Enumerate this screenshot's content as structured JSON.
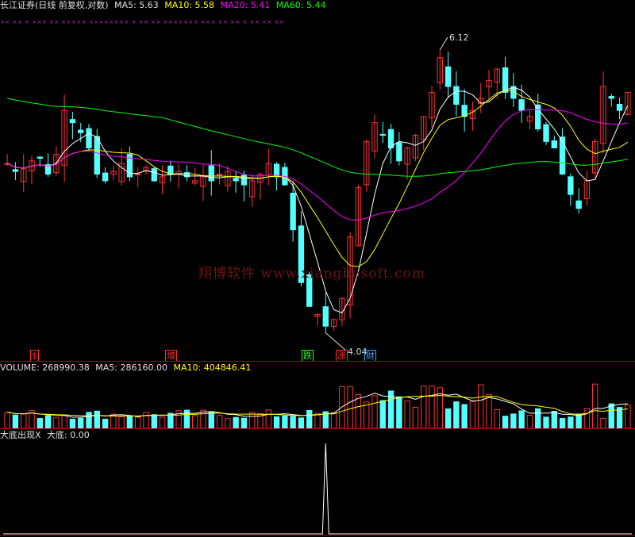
{
  "header": {
    "title": "长江证券(日线 前复权,对数)",
    "ma5_label": "MA5:",
    "ma5": "5.63",
    "ma10_label": "MA10:",
    "ma10": "5.58",
    "ma20_label": "MA20:",
    "ma20": "5.41",
    "ma60_label": "MA60:",
    "ma60": "5.44"
  },
  "price_panel": {
    "high_label": "6.12",
    "low_label": "4.04",
    "signal_marks": "×× ×× × ××× ×× ××××× ×××××××× × ×× ×× ××××××× ××× ×× ×× × ×× ×× ××",
    "event_flags": [
      {
        "text": "$",
        "color": "#ff3030"
      },
      {
        "text": "增",
        "color": "#ff3030"
      },
      {
        "text": "跌",
        "color": "#30ff30"
      },
      {
        "text": "涨",
        "color": "#ff3030"
      },
      {
        "text": "财",
        "color": "#4aa0ff"
      }
    ],
    "watermark": "翔博软件 www.xiangbosoft.com"
  },
  "volume_panel": {
    "label": "VOLUME:",
    "value": "268990.38",
    "ma5_label": "MA5:",
    "ma5": "286160.00",
    "ma10_label": "MA10:",
    "ma10": "404846.41"
  },
  "indicator_panel": {
    "label": "大底出现X",
    "series_label": "大底:",
    "value": "0.00"
  },
  "colors": {
    "up": "#ff3232",
    "down": "#54ffff",
    "ma5": "#ffffff",
    "ma10": "#ffff00",
    "ma20": "#ff00ff",
    "ma60": "#00ff00",
    "separator": "#a00000"
  },
  "chart_data": {
    "type": "candlestick",
    "price_axis": "log",
    "price_high": 6.12,
    "price_low": 4.04,
    "candles_close": [
      5.18,
      5.12,
      5.14,
      5.2,
      5.22,
      5.1,
      5.25,
      5.6,
      5.5,
      5.42,
      5.3,
      5.1,
      5.05,
      5.12,
      5.18,
      5.08,
      5.1,
      5.15,
      5.05,
      5.08,
      5.1,
      5.12,
      5.08,
      5.05,
      5.08,
      5.05,
      5.1,
      5.12,
      5.05,
      5.02,
      5.05,
      5.1,
      5.18,
      5.08,
      5.02,
      4.7,
      4.35,
      4.2,
      4.15,
      4.08,
      4.12,
      4.25,
      4.65,
      5.0,
      5.35,
      5.5,
      5.4,
      5.3,
      5.2,
      5.3,
      5.4,
      5.55,
      5.75,
      6.05,
      5.8,
      5.65,
      5.55,
      5.6,
      5.7,
      5.85,
      5.95,
      5.75,
      5.7,
      5.6,
      5.55,
      5.45,
      5.35,
      5.3,
      5.1,
      4.95,
      4.85,
      5.05,
      5.35,
      5.8,
      5.7,
      5.6,
      5.75
    ],
    "volume_ma5": 286160.0,
    "volume_ma10": 404846.41,
    "indicator_values_note": "大底 = 0 except a single spike at the 涨 day"
  }
}
